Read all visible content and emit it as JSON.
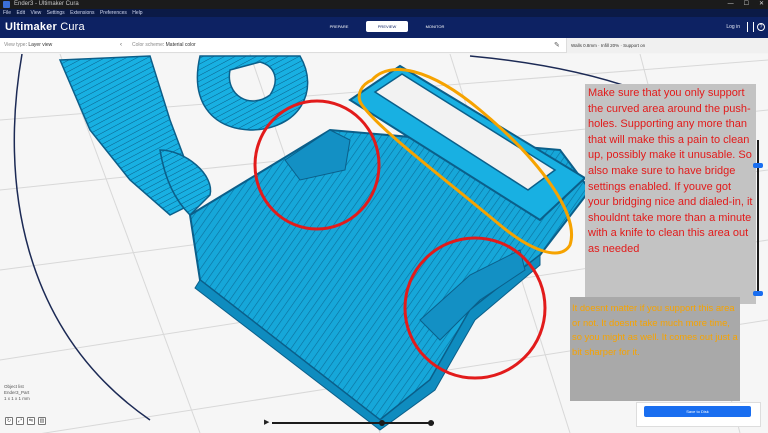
{
  "window": {
    "title": "Ender3 - Ultimaker Cura",
    "controls": [
      "—",
      "☐",
      "✕"
    ]
  },
  "menu": [
    "File",
    "Edit",
    "View",
    "Settings",
    "Extensions",
    "Preferences",
    "Help"
  ],
  "header": {
    "logo_bold": "Ultimaker",
    "logo_light": " Cura",
    "stages": [
      {
        "label": "PREPARE",
        "active": false
      },
      {
        "label": "PREVIEW",
        "active": true
      },
      {
        "label": "MONITOR",
        "active": false
      }
    ],
    "signin": "Log in"
  },
  "toolbar": {
    "view_type_label": "View type",
    "view_type_value": "Layer view",
    "back_icon": "chevron-left-icon",
    "color_scheme_label": "Color scheme",
    "color_scheme_value": "Material color",
    "edit_icon": "pencil-icon",
    "profile_summary": "Walls 0.8mm · Infill 20% · Support on"
  },
  "annotations": {
    "red_note": "Make sure that you only support the curved area around the push-holes. Supporting any more than that will make this a pain to clean up, possibly make it unusable. So also make sure to have bridge settings enabled. If youve got your bridging nice and dialed-in, it shouldnt take more than a minute with a knife to clean this area out as needed",
    "orange_note": "It doesnt matter if you support this area or not. It doesnt take much more time, so you might as well. It comes out just a bit sharper for it."
  },
  "colors": {
    "model": "#16a7d9",
    "model_dark": "#0b5f8a",
    "header": "#0d2263",
    "accent": "#196ef0",
    "red_circle": "#e21b1b",
    "orange_circle": "#f6a300"
  },
  "layer_slider": {
    "top_fraction": 0.84,
    "bottom_fraction": 0.0
  },
  "simulation": {
    "progress": 0.68,
    "play_icon": "play-icon"
  },
  "object_list": [
    "Object list",
    "Ender3_Part",
    "1 x 1 x 1 mm"
  ],
  "bottom_tool_icons": [
    "rotate-icon",
    "scale-icon",
    "mirror-icon",
    "support-icon"
  ],
  "slice_button": "Save to Disk"
}
